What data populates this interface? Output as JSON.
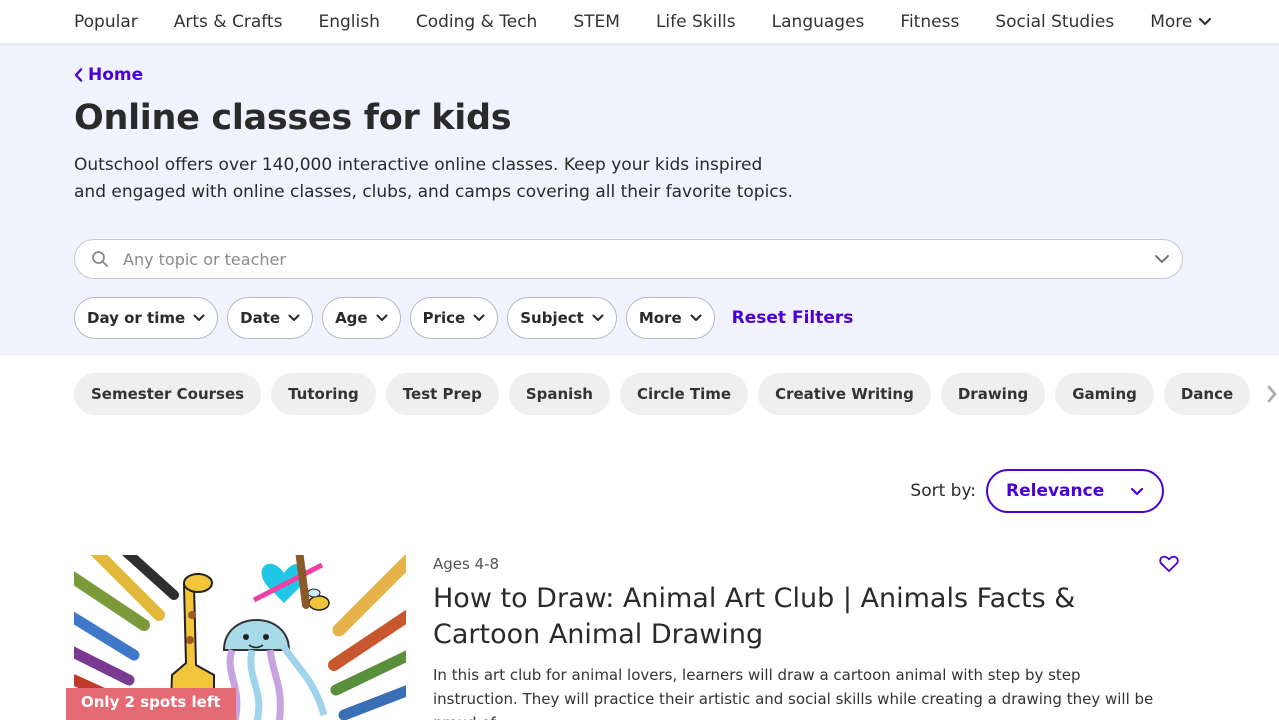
{
  "nav": {
    "items": [
      "Popular",
      "Arts & Crafts",
      "English",
      "Coding & Tech",
      "STEM",
      "Life Skills",
      "Languages",
      "Fitness",
      "Social Studies"
    ],
    "more": "More"
  },
  "breadcrumb": {
    "label": "Home"
  },
  "hero": {
    "title": "Online classes for kids",
    "description": "Outschool offers over 140,000 interactive online classes. Keep your kids inspired and engaged with online classes, clubs, and camps covering all their favorite topics."
  },
  "search": {
    "placeholder": "Any topic or teacher",
    "value": ""
  },
  "filters": {
    "day_time": "Day or time",
    "date": "Date",
    "age": "Age",
    "price": "Price",
    "subject": "Subject",
    "more": "More",
    "reset": "Reset Filters"
  },
  "chips": [
    "Semester Courses",
    "Tutoring",
    "Test Prep",
    "Spanish",
    "Circle Time",
    "Creative Writing",
    "Drawing",
    "Gaming",
    "Dance"
  ],
  "sort": {
    "label": "Sort by:",
    "value": "Relevance"
  },
  "listing": {
    "badge": "Only 2 spots left",
    "ages": "Ages 4-8",
    "title": "How to Draw: Animal Art Club | Animals Facts & Cartoon Animal Drawing",
    "summary": "In this art club for animal lovers, learners will draw a cartoon animal with step by step instruction. They will practice their artistic and social skills while creating a drawing they will be proud of."
  },
  "colors": {
    "accent": "#4b01d4",
    "hero_bg": "#f0f2fd",
    "badge": "#e46b74"
  }
}
